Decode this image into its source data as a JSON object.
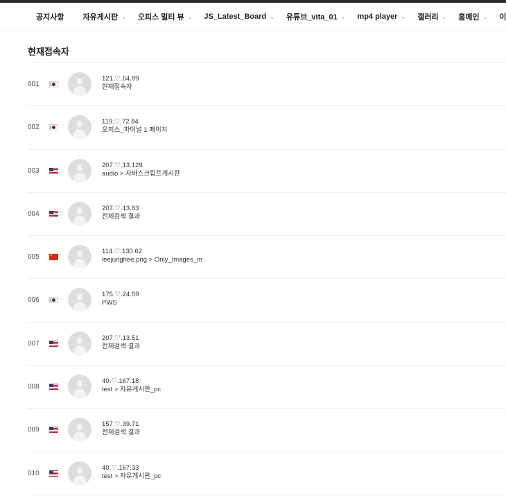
{
  "nav": {
    "items": [
      {
        "label": "공지사항",
        "dropdown": false
      },
      {
        "label": "자유게시판",
        "dropdown": true
      },
      {
        "label": "오피스 멀티 뷰",
        "dropdown": true
      },
      {
        "label": "JS_Latest_Board",
        "dropdown": true
      },
      {
        "label": "유튜브_vita_01",
        "dropdown": true
      },
      {
        "label": "mp4 player",
        "dropdown": true
      },
      {
        "label": "갤러리",
        "dropdown": true
      },
      {
        "label": "홈메인",
        "dropdown": true
      },
      {
        "label": "이벤트게시",
        "dropdown": false
      }
    ]
  },
  "page": {
    "title": "현재접속자"
  },
  "visitors": [
    {
      "num": "001",
      "flag": "kr",
      "ip": "121.♡.64.89",
      "location": "현재접속자"
    },
    {
      "num": "002",
      "flag": "kr",
      "ip": "119.♡.72.84",
      "location": "오피스_파이널 1 페이지"
    },
    {
      "num": "003",
      "flag": "us",
      "ip": "207.♡.13.129",
      "location": "audio > 자바스크립트게시판"
    },
    {
      "num": "004",
      "flag": "us",
      "ip": "207.♡.13.83",
      "location": "전체검색 결과"
    },
    {
      "num": "005",
      "flag": "cn",
      "ip": "114.♡.130.62",
      "location": "leejunghee.png > Only_Images_m"
    },
    {
      "num": "006",
      "flag": "kr",
      "ip": "175.♡.24.59",
      "location": "PWS"
    },
    {
      "num": "007",
      "flag": "us",
      "ip": "207.♡.13.51",
      "location": "전체검색 결과"
    },
    {
      "num": "008",
      "flag": "us",
      "ip": "40.♡.167.18",
      "location": "test > 자유게시판_pc"
    },
    {
      "num": "009",
      "flag": "us",
      "ip": "157.♡.39.71",
      "location": "전체검색 결과"
    },
    {
      "num": "010",
      "flag": "us",
      "ip": "40.♡.167.33",
      "location": "test > 자유게시판_pc"
    }
  ]
}
